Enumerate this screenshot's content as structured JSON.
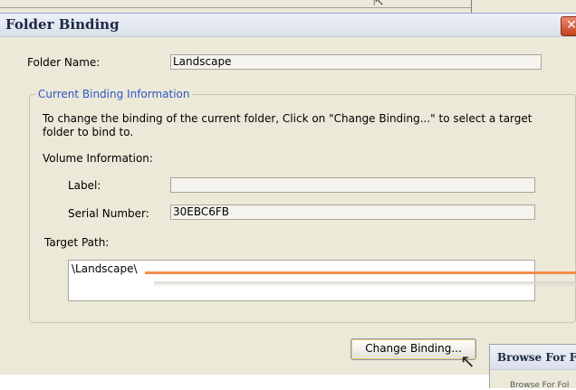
{
  "window": {
    "title": "Folder Binding",
    "close_glyph": "✕"
  },
  "folder_name": {
    "label": "Folder Name:",
    "value": "Landscape"
  },
  "binding_group": {
    "title": "Current Binding Information",
    "instructions": "To change the binding of the current folder, Click on \"Change Binding...\" to select a target",
    "instructions_line2": "folder to bind to.",
    "volume_info_label": "Volume Information:",
    "label_label": "Label:",
    "label_value": "",
    "serial_label": "Serial Number:",
    "serial_value": "30EBC6FB",
    "target_path_label": "Target Path:",
    "target_path_value": "\\Landscape\\"
  },
  "buttons": {
    "change_binding": "Change Binding..."
  },
  "background_dialog": {
    "title": "Browse For Fo",
    "subtitle": "Browse For Fol"
  },
  "colors": {
    "group_title": "#2e55c6",
    "annotation": "#f28e4b",
    "dialog_bg": "#ece9d8"
  },
  "icons": {
    "cursor": "arrow-pointer-icon",
    "close": "close-icon"
  }
}
